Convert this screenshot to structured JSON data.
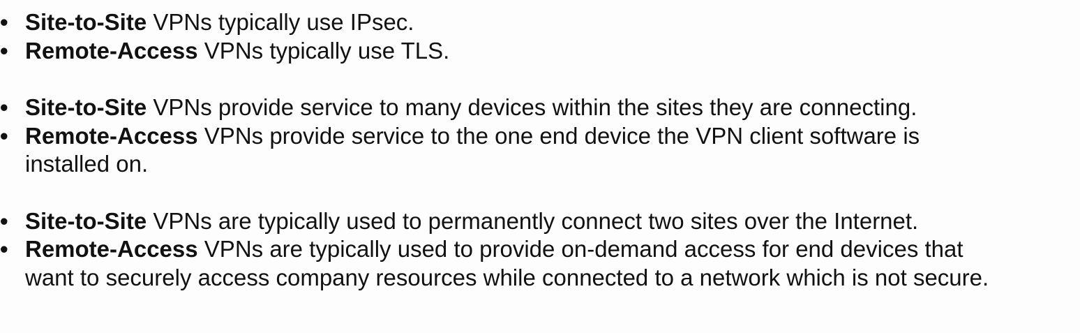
{
  "bullet_symbol": "•",
  "groups": [
    {
      "items": [
        {
          "term": "Site-to-Site",
          "line1": " VPNs typically use IPsec.",
          "line2": ""
        },
        {
          "term": "Remote-Access",
          "line1": " VPNs typically use TLS.",
          "line2": ""
        }
      ]
    },
    {
      "items": [
        {
          "term": "Site-to-Site",
          "line1": " VPNs provide service to many devices within the sites they are connecting.",
          "line2": ""
        },
        {
          "term": "Remote-Access",
          "line1": " VPNs provide service to the one end device the VPN client software is",
          "line2": "installed on."
        }
      ]
    },
    {
      "items": [
        {
          "term": "Site-to-Site",
          "line1": " VPNs are typically used to permanently connect two sites over the Internet.",
          "line2": ""
        },
        {
          "term": "Remote-Access",
          "line1": " VPNs are typically used to provide on-demand access for end devices that",
          "line2": "want to securely access company resources while connected to a network which is not secure."
        }
      ]
    }
  ]
}
